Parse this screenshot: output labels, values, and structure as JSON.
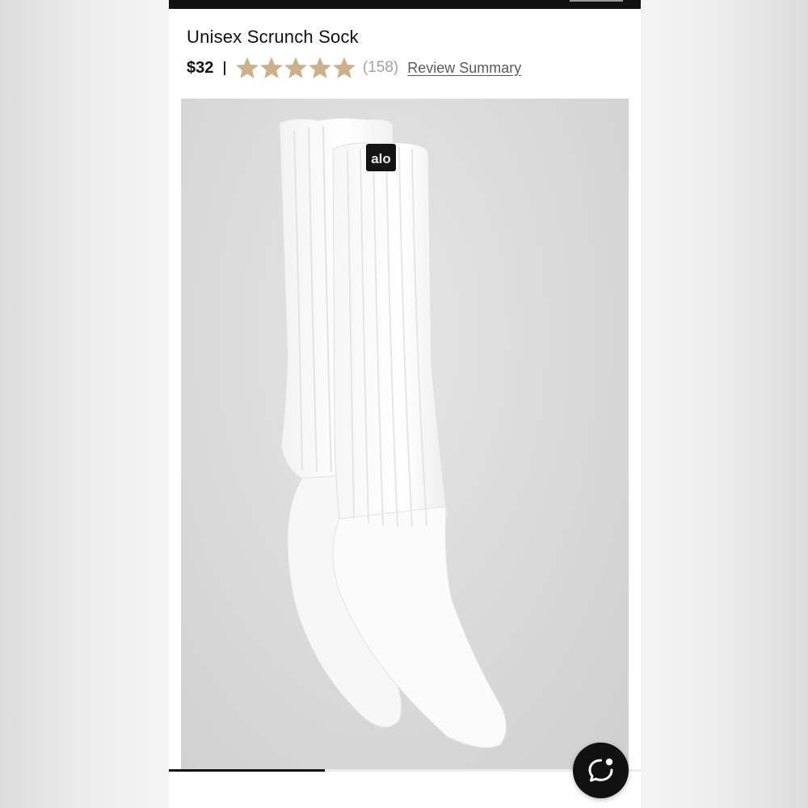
{
  "product": {
    "title": "Unisex Scrunch Sock",
    "price": "$32",
    "rating": {
      "stars": 5,
      "count_text": "(158)"
    },
    "review_summary_label": "Review Summary",
    "image": {
      "alt": "White scrunch sock with alo logo tag",
      "logo_text": "alo"
    }
  },
  "gallery": {
    "progress": 0.33
  },
  "chat": {
    "icon": "chat-bubble-icon"
  },
  "colors": {
    "star": "#CDB08A",
    "top_bar": "#111111",
    "chat_button": "#111111"
  }
}
